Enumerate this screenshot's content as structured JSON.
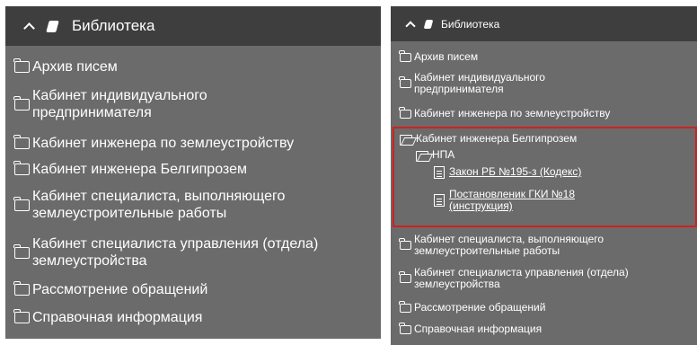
{
  "left_panel": {
    "header": {
      "title": "Библиотека"
    },
    "items": [
      "Архив писем",
      "Кабинет индивидуального предпринимателя",
      "Кабинет инженера по землеустройству",
      "Кабинет инженера Белгипрозем",
      "Кабинет специалиста, выполняющего землеустроительные работы",
      "Кабинет специалиста управления (отдела) землеустройства",
      "Рассмотрение обращений",
      "Справочная информация"
    ]
  },
  "right_panel": {
    "header": {
      "title": "Библиотека"
    },
    "items": [
      "Архив писем",
      "Кабинет индивидуального предпринимателя",
      "Кабинет инженера по землеустройству",
      "Кабинет инженера Белгипрозем",
      "Кабинет специалиста, выполняющего землеустроительные работы",
      "Кабинет специалиста управления (отдела) землеустройства",
      "Рассмотрение обращений",
      "Справочная информация"
    ],
    "expanded": {
      "subfolder": "НПА",
      "documents": [
        "Закон РБ №195-з (Кодекс)",
        "Постановленик ГКИ №18 (инструкция)"
      ]
    },
    "highlight_color": "#d02020"
  }
}
